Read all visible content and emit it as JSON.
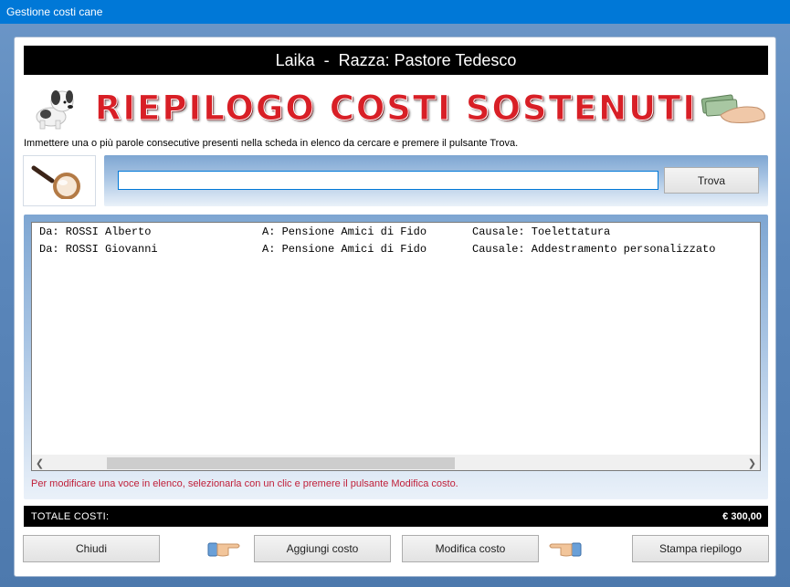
{
  "window": {
    "title": "Gestione costi cane"
  },
  "header": {
    "text": "Laika  -  Razza: Pastore Tedesco"
  },
  "banner": {
    "title": "RIEPILOGO COSTI SOSTENUTI",
    "left_image": "puppy-dog-image",
    "right_image": "hand-with-money-image"
  },
  "search": {
    "instruction": "Immettere una o più parole consecutive presenti nella scheda in elenco da cercare e premere il pulsante Trova.",
    "value": "",
    "button_label": "Trova",
    "icon": "magnifier-icon"
  },
  "list": {
    "rows": [
      {
        "from": "Da: ROSSI Alberto",
        "to": "A: Pensione Amici di Fido",
        "reason": "Causale: Toelettatura"
      },
      {
        "from": "Da: ROSSI Giovanni",
        "to": "A: Pensione Amici di Fido",
        "reason": "Causale: Addestramento personalizzato"
      }
    ],
    "hint": "Per modificare una voce in elenco, selezionarla con un clic e premere il pulsante Modifica costo."
  },
  "total": {
    "label": "TOTALE COSTI:",
    "value": "€ 300,00"
  },
  "buttons": {
    "close": "Chiudi",
    "add": "Aggiungi costo",
    "edit": "Modifica costo",
    "print": "Stampa riepilogo"
  },
  "colors": {
    "titlebar": "#0078d7",
    "background": "#5b87bb",
    "banner_red": "#d81f26",
    "hint_red": "#c0203a"
  }
}
